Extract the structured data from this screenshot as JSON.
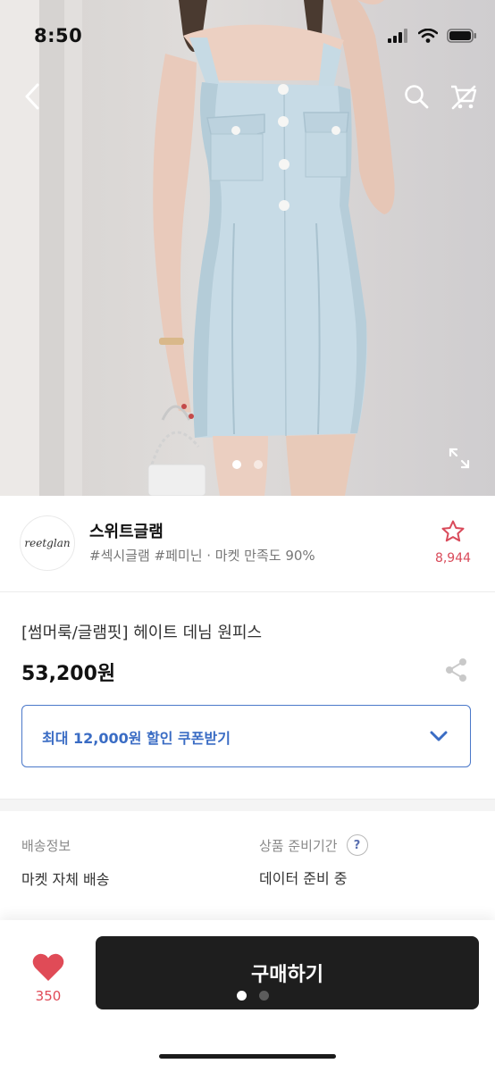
{
  "status_bar": {
    "time": "8:50"
  },
  "hero": {
    "icons": [
      "back-arrow-icon",
      "search-icon",
      "cart-off-icon",
      "expand-icon"
    ],
    "slide_count": 2,
    "active_slide": 1
  },
  "shop": {
    "logo_text": "reetglan",
    "name": "스위트글램",
    "tags": "#섹시글램 #페미닌 · 마켓 만족도 90%",
    "favorite_count": "8,944"
  },
  "product": {
    "title": "[썸머룩/글램핏] 헤이트 데님 원피스",
    "price": "53,200원",
    "coupon_label": "최대 12,000원 할인 쿠폰받기"
  },
  "shipping": {
    "info_label": "배송정보",
    "info_value": "마켓 자체 배송",
    "prep_label": "상품 준비기간",
    "prep_value": "데이터 준비 중",
    "help_glyph": "?"
  },
  "bottom_bar": {
    "like_count": "350",
    "buy_label": "구매하기"
  },
  "colors": {
    "accent_blue": "#3a6cc4",
    "heart_red": "#e04b57",
    "star_red": "#d94a5a",
    "buy_button": "#1e1e1e"
  }
}
